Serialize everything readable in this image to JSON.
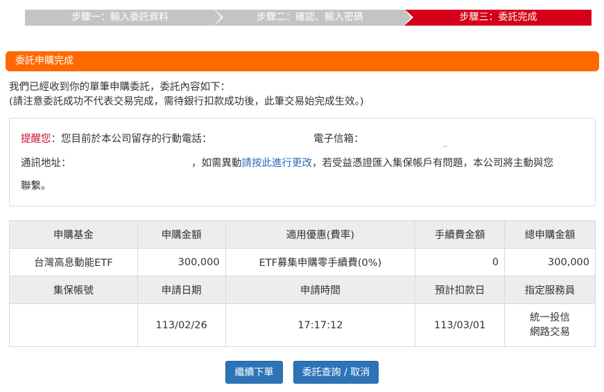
{
  "steps": [
    {
      "label": "步驟一：輸入委託資料",
      "active": false
    },
    {
      "label": "步驟二：確認、輸入密碼",
      "active": false
    },
    {
      "label": "步驟三：委託完成",
      "active": true
    }
  ],
  "colors": {
    "active_step": "#d4001a",
    "inactive_step": "#c4c4c4",
    "section_bar": "#ff6a00",
    "button": "#2d73b8",
    "link": "#2a6bb6",
    "warn": "#c8102e"
  },
  "section": {
    "title": "委託申購完成"
  },
  "intro": {
    "line1": "我們已經收到你的單筆申購委託，委託內容如下：",
    "line2": "(請注意委託成功不代表交易完成，需待銀行扣款成功後，此筆交易始完成生效。)"
  },
  "notice": {
    "warn_label": "提醒您",
    "phone_text": "：您目前於本公司留存的行動電話：",
    "email_label": "電子信箱：",
    "mark": "..",
    "address_label": "通訊地址：",
    "change_prefix": "，如需異動",
    "change_link": "請按此進行更改",
    "change_suffix": "，若受益憑證匯入集保帳戶有問題，本公司將主動與您",
    "contact_end": "聯繫。"
  },
  "table": {
    "header1": [
      "申購基金",
      "申購金額",
      "適用優惠(費率)",
      "手續費金額",
      "總申購金額"
    ],
    "row1": [
      "台灣高息動能ETF",
      "300,000",
      "ETF募集申購零手續費(0%)",
      "0",
      "300,000"
    ],
    "header2": [
      "集保帳號",
      "申請日期",
      "申請時間",
      "預計扣款日",
      "指定服務員"
    ],
    "row2": [
      "",
      "113/02/26",
      "17:17:12",
      "113/03/01"
    ],
    "service_line1": "統一投信",
    "service_line2": "網路交易"
  },
  "buttons": {
    "continue": "繼續下單",
    "query": "委託查詢 / 取消"
  }
}
